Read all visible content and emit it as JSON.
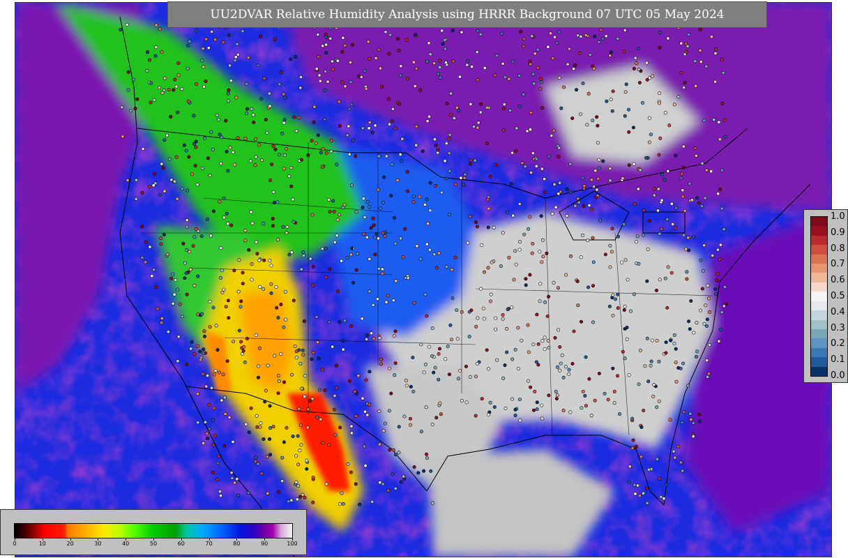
{
  "title": "UU2DVAR Relative Humidity Analysis using HRRR Background 07 UTC 05 May 2024",
  "map": {
    "projection": "Lambert Conformal",
    "region": "CONUS",
    "land_missing_color": "#c9c9c9"
  },
  "rh_colorbar": {
    "tick_labels": [
      "0",
      "10",
      "20",
      "30",
      "40",
      "50",
      "60",
      "70",
      "80",
      "90",
      "100"
    ],
    "stops": [
      {
        "v": 0,
        "c": "#000000"
      },
      {
        "v": 4,
        "c": "#4a0000"
      },
      {
        "v": 8,
        "c": "#b00000"
      },
      {
        "v": 11,
        "c": "#ff0000"
      },
      {
        "v": 18,
        "c": "#ff2000"
      },
      {
        "v": 19,
        "c": "#ff7a00"
      },
      {
        "v": 25,
        "c": "#ffa800"
      },
      {
        "v": 32,
        "c": "#ffe800"
      },
      {
        "v": 38,
        "c": "#b8ff00"
      },
      {
        "v": 43,
        "c": "#55ff00"
      },
      {
        "v": 50,
        "c": "#00cc00"
      },
      {
        "v": 58,
        "c": "#00a000"
      },
      {
        "v": 62,
        "c": "#00c8a8"
      },
      {
        "v": 68,
        "c": "#00a8ff"
      },
      {
        "v": 75,
        "c": "#0060ff"
      },
      {
        "v": 81,
        "c": "#0018e0"
      },
      {
        "v": 86,
        "c": "#3000c8"
      },
      {
        "v": 90,
        "c": "#7000a8"
      },
      {
        "v": 93,
        "c": "#a000b0"
      },
      {
        "v": 96,
        "c": "#d8a8d8"
      },
      {
        "v": 100,
        "c": "#f4f4f4"
      }
    ]
  },
  "obs_colorbar": {
    "tick_labels": [
      "1.0",
      "0.9",
      "0.8",
      "0.7",
      "0.6",
      "0.5",
      "0.4",
      "0.3",
      "0.2",
      "0.1",
      "0.0"
    ],
    "colors": [
      "#08306b",
      "#1f5a9a",
      "#3a7ab3",
      "#5c95c2",
      "#7aa7b8",
      "#9fc2c4",
      "#c4d6dd",
      "#e6e8ec",
      "#f4f4f4",
      "#f6d8c8",
      "#f0b89a",
      "#e8966e",
      "#dd7351",
      "#cf4f3c",
      "#bb2a2c",
      "#9a1020",
      "#7f0a1a"
    ]
  }
}
